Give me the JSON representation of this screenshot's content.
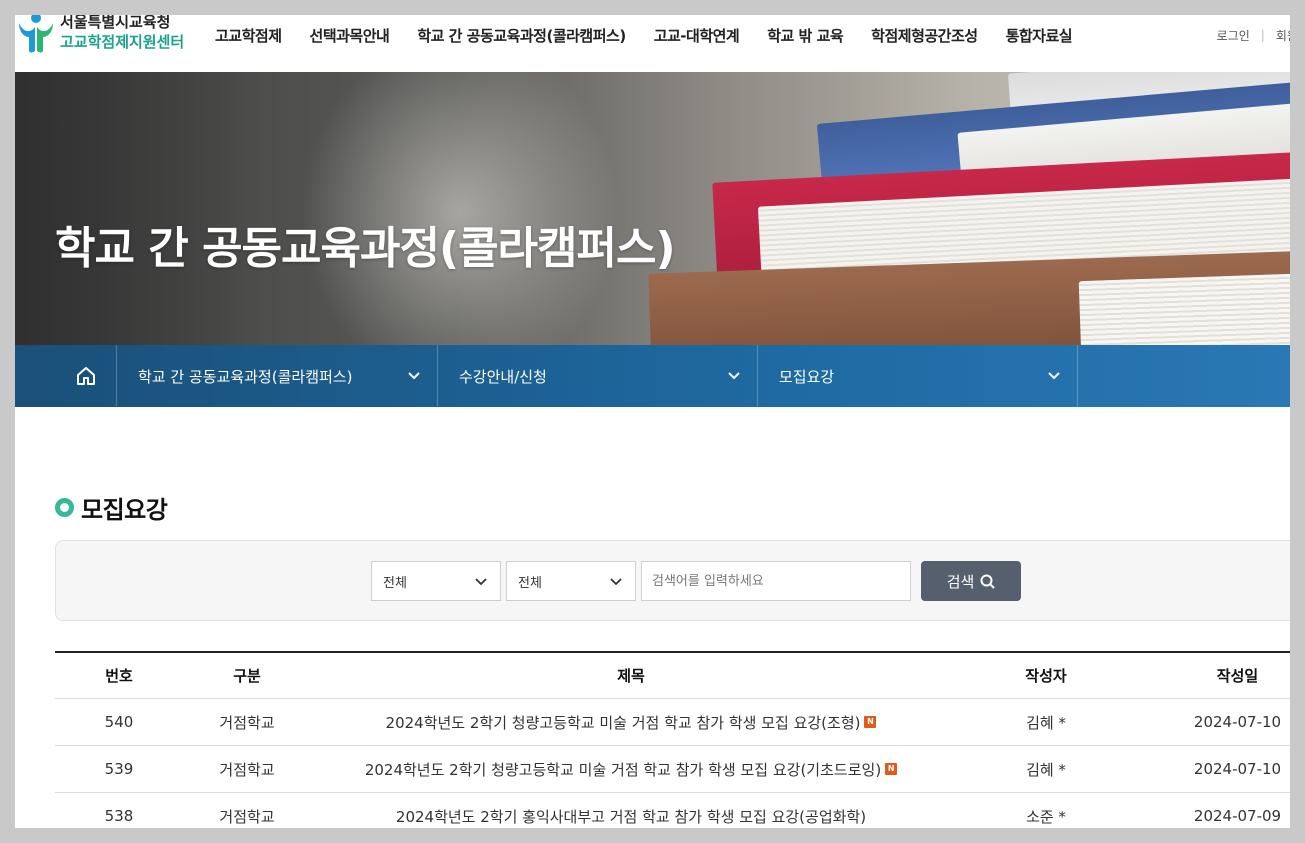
{
  "header": {
    "logo_line1": "서울특별시교육청",
    "logo_line2": "고교학점제지원센터",
    "nav": [
      "고교학점제",
      "선택과목안내",
      "학교 간 공동교육과정(콜라캠퍼스)",
      "고교-대학연계",
      "학교 밖 교육",
      "학점제형공간조성",
      "통합자료실"
    ],
    "login": "로그인",
    "signup": "회원가입"
  },
  "hero": {
    "title": "학교 간 공동교육과정(콜라캠퍼스)"
  },
  "breadcrumb": {
    "items": [
      "학교 간 공동교육과정(콜라캠퍼스)",
      "수강안내/신청",
      "모집요강"
    ]
  },
  "section": {
    "title": "모집요강"
  },
  "search": {
    "select1": "전체",
    "select2": "전체",
    "placeholder": "검색어를 입력하세요",
    "button": "검색"
  },
  "table": {
    "headers": [
      "번호",
      "구분",
      "제목",
      "작성자",
      "작성일"
    ],
    "rows": [
      {
        "no": "540",
        "cat": "거점학교",
        "title": "2024학년도 2학기 청량고등학교 미술 거점 학교 참가 학생 모집 요강(조형)",
        "new": "N",
        "author": "김혜 *",
        "date": "2024-07-10"
      },
      {
        "no": "539",
        "cat": "거점학교",
        "title": "2024학년도 2학기 청량고등학교 미술 거점 학교 참가 학생 모집 요강(기초드로잉)",
        "new": "N",
        "author": "김혜 *",
        "date": "2024-07-10"
      },
      {
        "no": "538",
        "cat": "거점학교",
        "title": "2024학년도 2학기 홍익사대부고 거점 학교 참가 학생 모집 요강(공업화학)",
        "new": "",
        "author": "소준 *",
        "date": "2024-07-09"
      }
    ]
  },
  "colors": {
    "brand_green": "#1ba38a",
    "crumb_blue": "#1e6aa2",
    "search_button": "#555f6e",
    "new_badge": "#e05b1b"
  }
}
